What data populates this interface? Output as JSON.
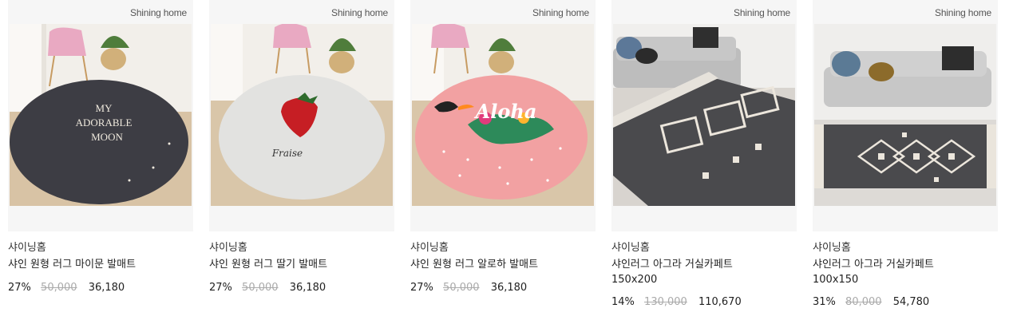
{
  "products": [
    {
      "brand": "샤이닝홈",
      "title": "샤인 원형 러그 마이문 발매트",
      "size": "",
      "discount": "27%",
      "original_price": "50,000",
      "sale_price": "36,180",
      "watermark": "Shining home",
      "image_text": [
        "MY",
        "ADORABLE",
        "MOON"
      ]
    },
    {
      "brand": "샤이닝홈",
      "title": "샤인 원형 러그 딸기 발매트",
      "size": "",
      "discount": "27%",
      "original_price": "50,000",
      "sale_price": "36,180",
      "watermark": "Shining home",
      "image_text": [
        "Fraise"
      ]
    },
    {
      "brand": "샤이닝홈",
      "title": "샤인 원형 러그 알로하 발매트",
      "size": "",
      "discount": "27%",
      "original_price": "50,000",
      "sale_price": "36,180",
      "watermark": "Shining home",
      "image_text": [
        "Aloha"
      ]
    },
    {
      "brand": "샤이닝홈",
      "title": "샤인러그 아그라 거실카페트",
      "size": "150x200",
      "discount": "14%",
      "original_price": "130,000",
      "sale_price": "110,670",
      "watermark": "Shining home",
      "image_text": []
    },
    {
      "brand": "샤이닝홈",
      "title": "샤인러그 아그라 거실카페트",
      "size": "100x150",
      "discount": "31%",
      "original_price": "80,000",
      "sale_price": "54,780",
      "watermark": "Shining home",
      "image_text": []
    }
  ]
}
